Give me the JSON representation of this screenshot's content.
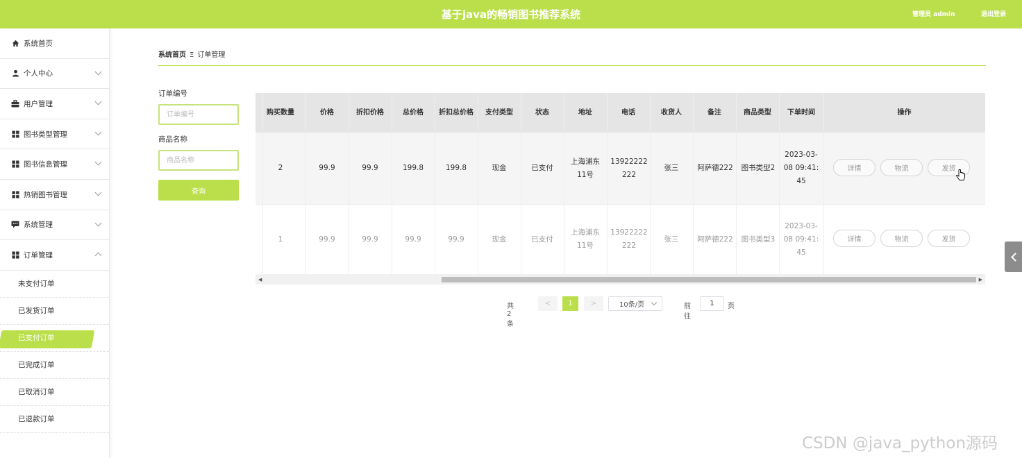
{
  "header": {
    "title": "基于java的畅销图书推荐系统",
    "admin_label": "管理员 admin",
    "logout_label": "退出登录",
    "accent_color": "#bbdf4b"
  },
  "sidebar": {
    "items": [
      {
        "label": "系统首页",
        "icon": "home-icon"
      },
      {
        "label": "个人中心",
        "icon": "user-icon"
      },
      {
        "label": "用户管理",
        "icon": "briefcase-icon"
      },
      {
        "label": "图书类型管理",
        "icon": "grid-icon"
      },
      {
        "label": "图书信息管理",
        "icon": "grid-icon"
      },
      {
        "label": "热销图书管理",
        "icon": "grid-icon"
      },
      {
        "label": "系统管理",
        "icon": "chat-icon"
      },
      {
        "label": "订单管理",
        "icon": "grid-icon"
      }
    ],
    "sub_items": [
      {
        "label": "未支付订单"
      },
      {
        "label": "已发货订单"
      },
      {
        "label": "已支付订单",
        "active": true
      },
      {
        "label": "已完成订单"
      },
      {
        "label": "已取消订单"
      },
      {
        "label": "已退款订单"
      }
    ]
  },
  "breadcrumb": {
    "home": "系统首页",
    "separator": "Ξ",
    "current": "订单管理"
  },
  "filters": {
    "order_no_label": "订单编号",
    "order_no_placeholder": "订单编号",
    "product_label": "商品名称",
    "product_placeholder": "商品名称",
    "query_button": "查询"
  },
  "table": {
    "columns": [
      "购买数量",
      "价格",
      "折扣价格",
      "总价格",
      "折扣总价格",
      "支付类型",
      "状态",
      "地址",
      "电话",
      "收货人",
      "备注",
      "商品类型",
      "下单时间",
      "操作"
    ],
    "rows": [
      {
        "qty": "2",
        "price": "99.9",
        "discount_price": "99.9",
        "total": "199.8",
        "discount_total": "199.8",
        "pay_type": "现金",
        "status": "已支付",
        "address": "上海浦东11号",
        "phone": "13922222222",
        "receiver": "张三",
        "remark": "阿萨德222",
        "category": "图书类型2",
        "time": "2023-03-08 09:41:45"
      },
      {
        "qty": "1",
        "price": "99.9",
        "discount_price": "99.9",
        "total": "99.9",
        "discount_total": "99.9",
        "pay_type": "现金",
        "status": "已支付",
        "address": "上海浦东11号",
        "phone": "13922222222",
        "receiver": "张三",
        "remark": "阿萨德222",
        "category": "图书类型3",
        "time": "2023-03-08 09:41:45"
      }
    ],
    "actions": {
      "detail": "详情",
      "logistics": "物流",
      "ship": "发货"
    }
  },
  "pagination": {
    "total": "共 2 条",
    "prev": "<",
    "current_page": "1",
    "next": ">",
    "page_size": "10条/页",
    "goto_label": "前往",
    "goto_value": "1",
    "goto_unit": "页"
  },
  "watermark": "CSDN @java_python源码"
}
